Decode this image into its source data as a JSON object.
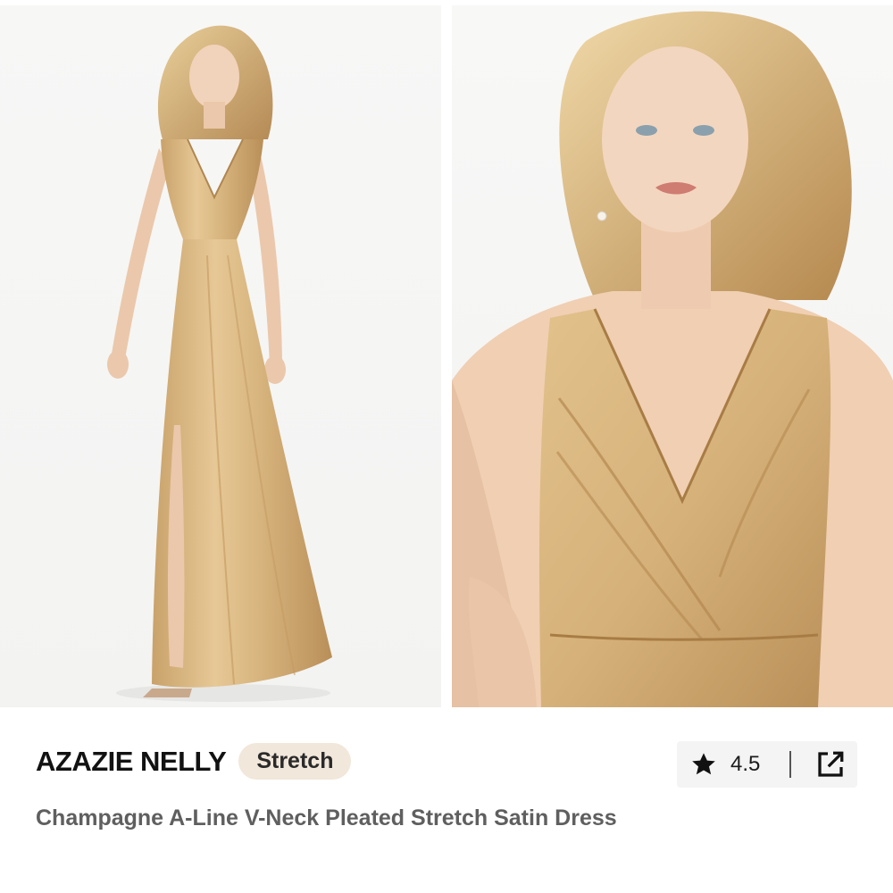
{
  "product": {
    "brand": "AZAZIE NELLY",
    "badge": "Stretch",
    "rating": "4.5",
    "description": "Champagne A-Line V-Neck Pleated Stretch Satin Dress"
  },
  "icons": {
    "rating": "star-icon",
    "share": "external-link-icon"
  },
  "colors": {
    "badge_background": "#f1e7da",
    "dress": "#d9b67e",
    "text_primary": "#121212",
    "text_secondary": "#5f5f5f"
  }
}
